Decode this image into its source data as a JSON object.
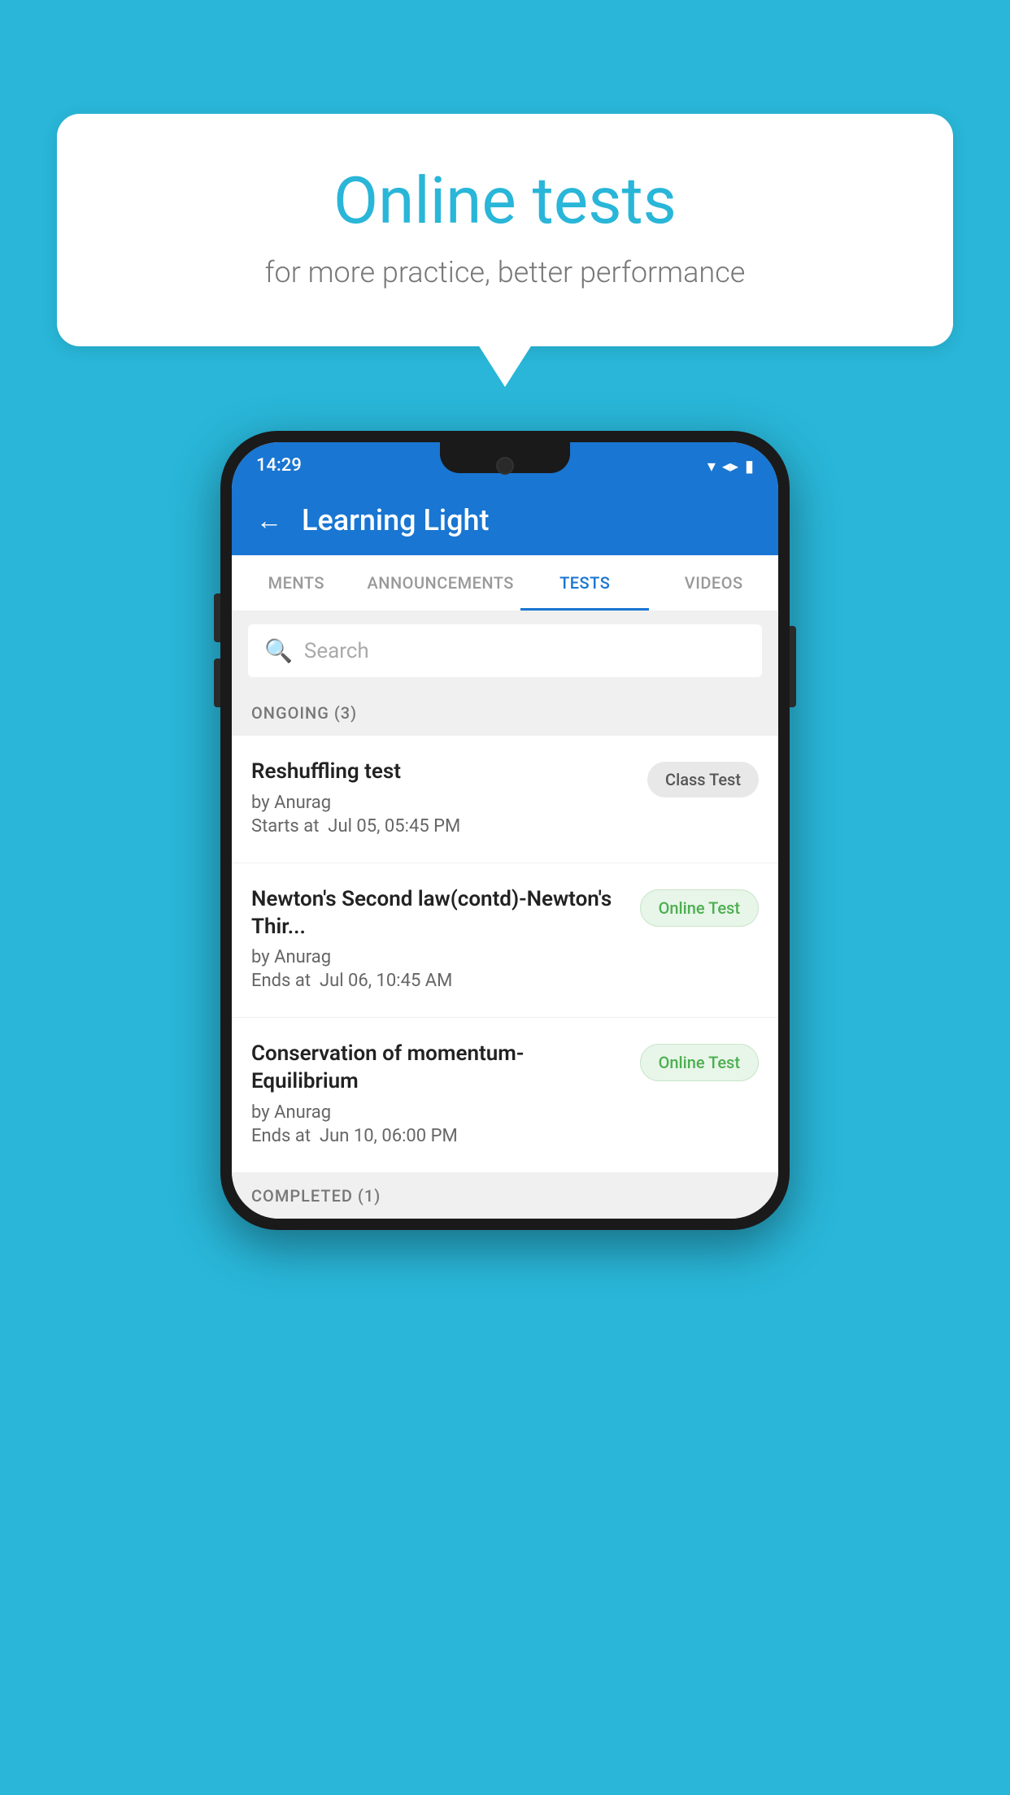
{
  "background_color": "#29B6D8",
  "bubble": {
    "title": "Online tests",
    "subtitle": "for more practice, better performance"
  },
  "phone": {
    "status_bar": {
      "time": "14:29",
      "icons": [
        "wifi",
        "signal",
        "battery"
      ]
    },
    "app_bar": {
      "title": "Learning Light",
      "back_label": "←"
    },
    "tabs": [
      {
        "label": "MENTS",
        "active": false
      },
      {
        "label": "ANNOUNCEMENTS",
        "active": false
      },
      {
        "label": "TESTS",
        "active": true
      },
      {
        "label": "VIDEOS",
        "active": false
      }
    ],
    "search": {
      "placeholder": "Search"
    },
    "ongoing_section": {
      "label": "ONGOING (3)",
      "tests": [
        {
          "title": "Reshuffling test",
          "by": "by Anurag",
          "time": "Starts at  Jul 05, 05:45 PM",
          "badge": "Class Test",
          "badge_type": "class"
        },
        {
          "title": "Newton's Second law(contd)-Newton's Thir...",
          "by": "by Anurag",
          "time": "Ends at  Jul 06, 10:45 AM",
          "badge": "Online Test",
          "badge_type": "online"
        },
        {
          "title": "Conservation of momentum-Equilibrium",
          "by": "by Anurag",
          "time": "Ends at  Jun 10, 06:00 PM",
          "badge": "Online Test",
          "badge_type": "online"
        }
      ]
    },
    "completed_section": {
      "label": "COMPLETED (1)"
    }
  }
}
